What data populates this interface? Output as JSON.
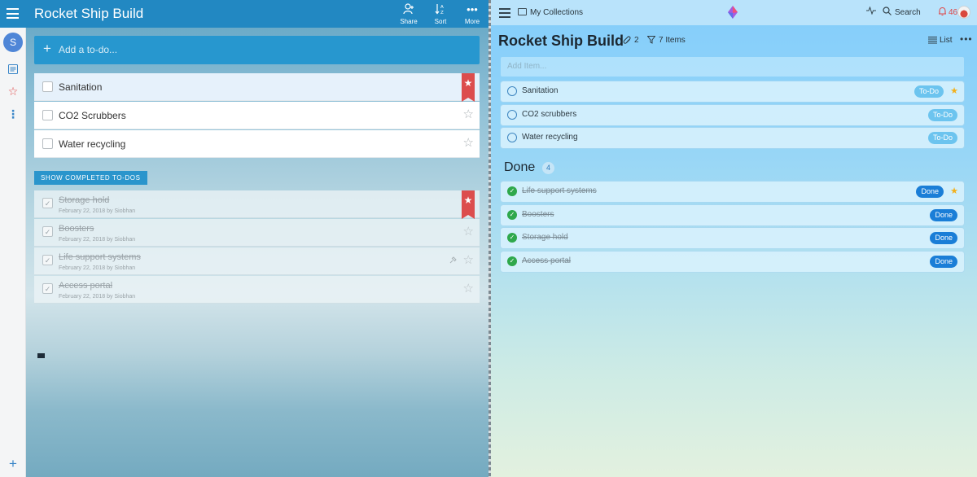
{
  "left_app": {
    "title": "Rocket Ship Build",
    "toolbar": {
      "share_label": "Share",
      "sort_label": "Sort",
      "more_label": "More"
    },
    "user_initial": "S",
    "add_placeholder": "Add a to-do...",
    "todos": [
      {
        "label": "Sanitation",
        "starred": true,
        "selected": true
      },
      {
        "label": "CO2 Scrubbers",
        "starred": false
      },
      {
        "label": "Water recycling",
        "starred": false
      }
    ],
    "show_completed_label": "SHOW COMPLETED TO-DOS",
    "completed": [
      {
        "label": "Storage hold",
        "meta": "February 22, 2018 by Siobhan",
        "starred": true
      },
      {
        "label": "Boosters",
        "meta": "February 22, 2018 by Siobhan",
        "starred": false
      },
      {
        "label": "Life support systems",
        "meta": "February 22, 2018 by Siobhan",
        "starred": false
      },
      {
        "label": "Access portal",
        "meta": "February 22, 2018 by Siobhan",
        "starred": false
      }
    ],
    "colors": {
      "header": "#2288c2",
      "accent": "#2797cf",
      "ribbon": "#dc4d4d"
    }
  },
  "right_app": {
    "breadcrumb": "My Collections",
    "search_label": "Search",
    "notification_count": "46",
    "page_title": "Rocket Ship Build",
    "attachments_count": "2",
    "items_label": "7 Items",
    "view_label": "List",
    "add_placeholder": "Add Item...",
    "items": [
      {
        "label": "Sanitation",
        "status": "To-Do",
        "starred": true
      },
      {
        "label": "CO2 scrubbers",
        "status": "To-Do",
        "starred": false
      },
      {
        "label": "Water recycling",
        "status": "To-Do",
        "starred": false
      }
    ],
    "done_header": "Done",
    "done_count": "4",
    "done_items": [
      {
        "label": "Life support systems",
        "status": "Done",
        "starred": true
      },
      {
        "label": "Boosters",
        "status": "Done",
        "starred": false
      },
      {
        "label": "Storage hold",
        "status": "Done",
        "starred": false
      },
      {
        "label": "Access portal",
        "status": "Done",
        "starred": false
      }
    ],
    "colors": {
      "todo_pill": "#6cc4ef",
      "done_pill": "#1a7ed7",
      "star": "#f3b01b",
      "check": "#2fa84c"
    }
  }
}
